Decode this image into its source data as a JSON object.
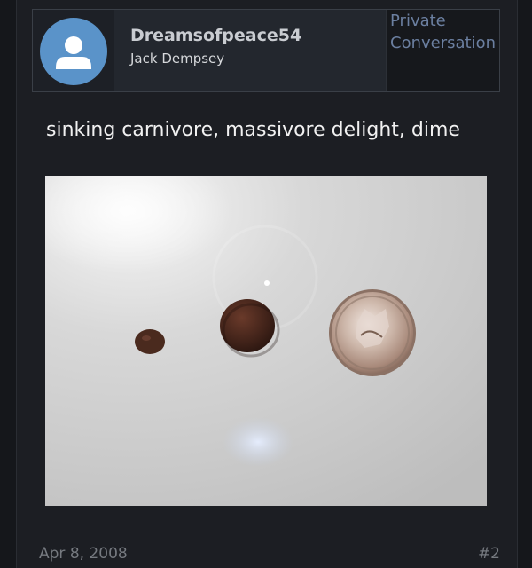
{
  "post": {
    "username": "Dreamsofpeace54",
    "user_title": "Jack Dempsey",
    "private_label": "Private Conversation",
    "message": "sinking carnivore, massivore delight, dime",
    "date": "Apr 8, 2008",
    "post_number": "#2"
  },
  "icons": {
    "avatar": "user-silhouette-icon"
  },
  "colors": {
    "background": "#15171b",
    "panel": "#1c1e23",
    "avatar_bg": "#5a93c9",
    "muted_text": "#767a80",
    "link_muted": "#6b7fa0"
  }
}
